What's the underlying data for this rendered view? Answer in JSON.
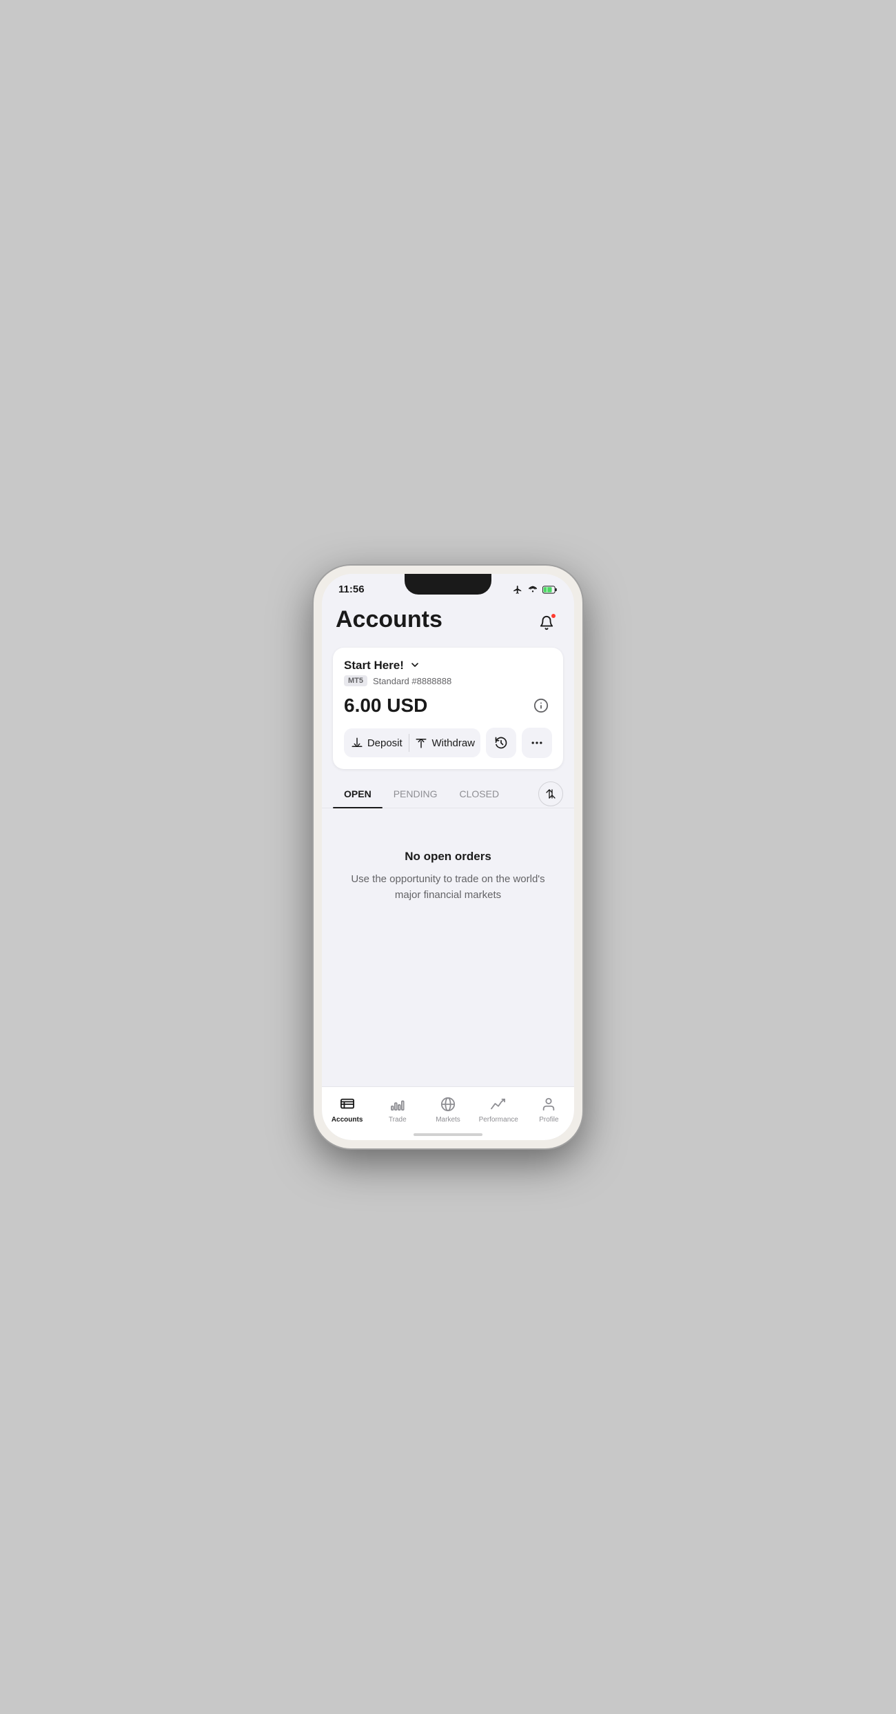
{
  "statusBar": {
    "time": "11:56"
  },
  "header": {
    "title": "Accounts",
    "bellLabel": "notifications"
  },
  "accountCard": {
    "accountName": "Start Here!",
    "accountType": "MT5",
    "accountSubtype": "Standard #8888888",
    "balance": "6.00 USD",
    "depositLabel": "Deposit",
    "withdrawLabel": "Withdraw"
  },
  "tabs": {
    "items": [
      {
        "label": "OPEN",
        "active": true
      },
      {
        "label": "PENDING",
        "active": false
      },
      {
        "label": "CLOSED",
        "active": false
      }
    ]
  },
  "emptyState": {
    "title": "No open orders",
    "subtitle": "Use the opportunity to trade on the world's major financial markets"
  },
  "bottomNav": {
    "items": [
      {
        "label": "Accounts",
        "active": true
      },
      {
        "label": "Trade",
        "active": false
      },
      {
        "label": "Markets",
        "active": false
      },
      {
        "label": "Performance",
        "active": false
      },
      {
        "label": "Profile",
        "active": false
      }
    ]
  }
}
